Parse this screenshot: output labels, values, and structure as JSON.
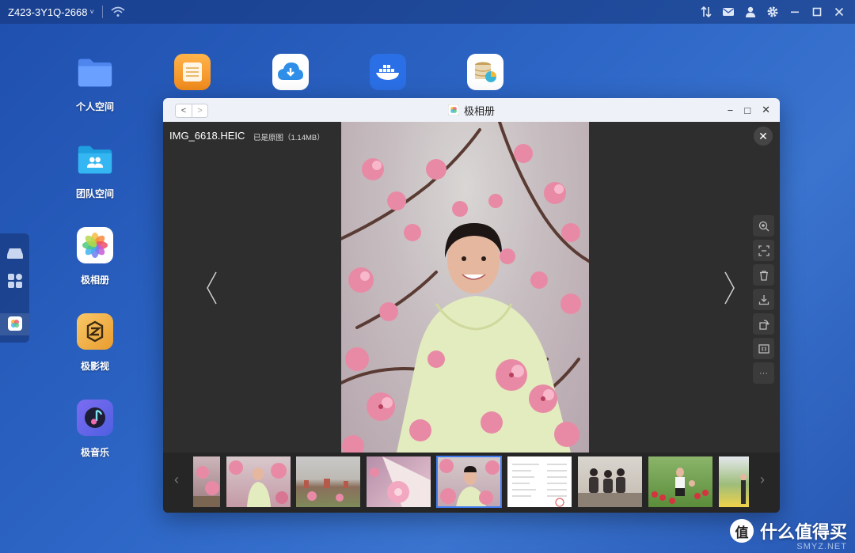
{
  "topbar": {
    "device_name": "Z423-3Y1Q-2668",
    "chevron": "˅",
    "icons": [
      "wifi-icon",
      "transfer-icon",
      "mail-icon",
      "user-icon",
      "gear-icon",
      "minimize-icon",
      "maximize-icon",
      "close-icon"
    ]
  },
  "desktop": {
    "icons": [
      {
        "label": "个人空间",
        "icon": "folder-icon"
      },
      {
        "label": "团队空间",
        "icon": "team-folder-icon"
      },
      {
        "label": "极相册",
        "icon": "photos-icon"
      },
      {
        "label": "极影视",
        "icon": "video-icon"
      },
      {
        "label": "极音乐",
        "icon": "music-icon"
      }
    ],
    "top_row_icons": [
      "notes-icon",
      "cloud-download-icon",
      "docker-icon",
      "database-icon"
    ]
  },
  "dock": {
    "items": [
      "drive-icon",
      "apps-grid-icon",
      "photos-icon"
    ]
  },
  "window": {
    "title": "极相册",
    "back": "<",
    "forward": ">",
    "controls": {
      "minimize": "−",
      "maximize": "□",
      "close": "✕"
    }
  },
  "viewer": {
    "file_name": "IMG_6618.HEIC",
    "file_meta": "已是原图（1.14MB）",
    "close": "✕",
    "tools": [
      "search-zoom-icon",
      "scan-icon",
      "trash-icon",
      "download-icon",
      "rotate-icon",
      "fit-icon",
      "more-icon"
    ],
    "more_label": "···"
  },
  "filmstrip": {
    "prev": "‹",
    "next": "›",
    "thumbnails": [
      {
        "name": "thumb-1",
        "selected": false
      },
      {
        "name": "thumb-2",
        "selected": false
      },
      {
        "name": "thumb-3",
        "selected": false
      },
      {
        "name": "thumb-4",
        "selected": false
      },
      {
        "name": "thumb-5",
        "selected": true
      },
      {
        "name": "thumb-6",
        "selected": false
      },
      {
        "name": "thumb-7",
        "selected": false
      },
      {
        "name": "thumb-8",
        "selected": false
      },
      {
        "name": "thumb-9",
        "selected": false
      }
    ]
  },
  "watermark": {
    "icon_text": "值",
    "text": "什么值得买",
    "sub": "SMYZ.NET"
  },
  "colors": {
    "desktop_bg": "#2d66c6",
    "window_bg": "#2e2e2e",
    "selection": "#3f7cf0",
    "blossom": "#e88aa6"
  }
}
